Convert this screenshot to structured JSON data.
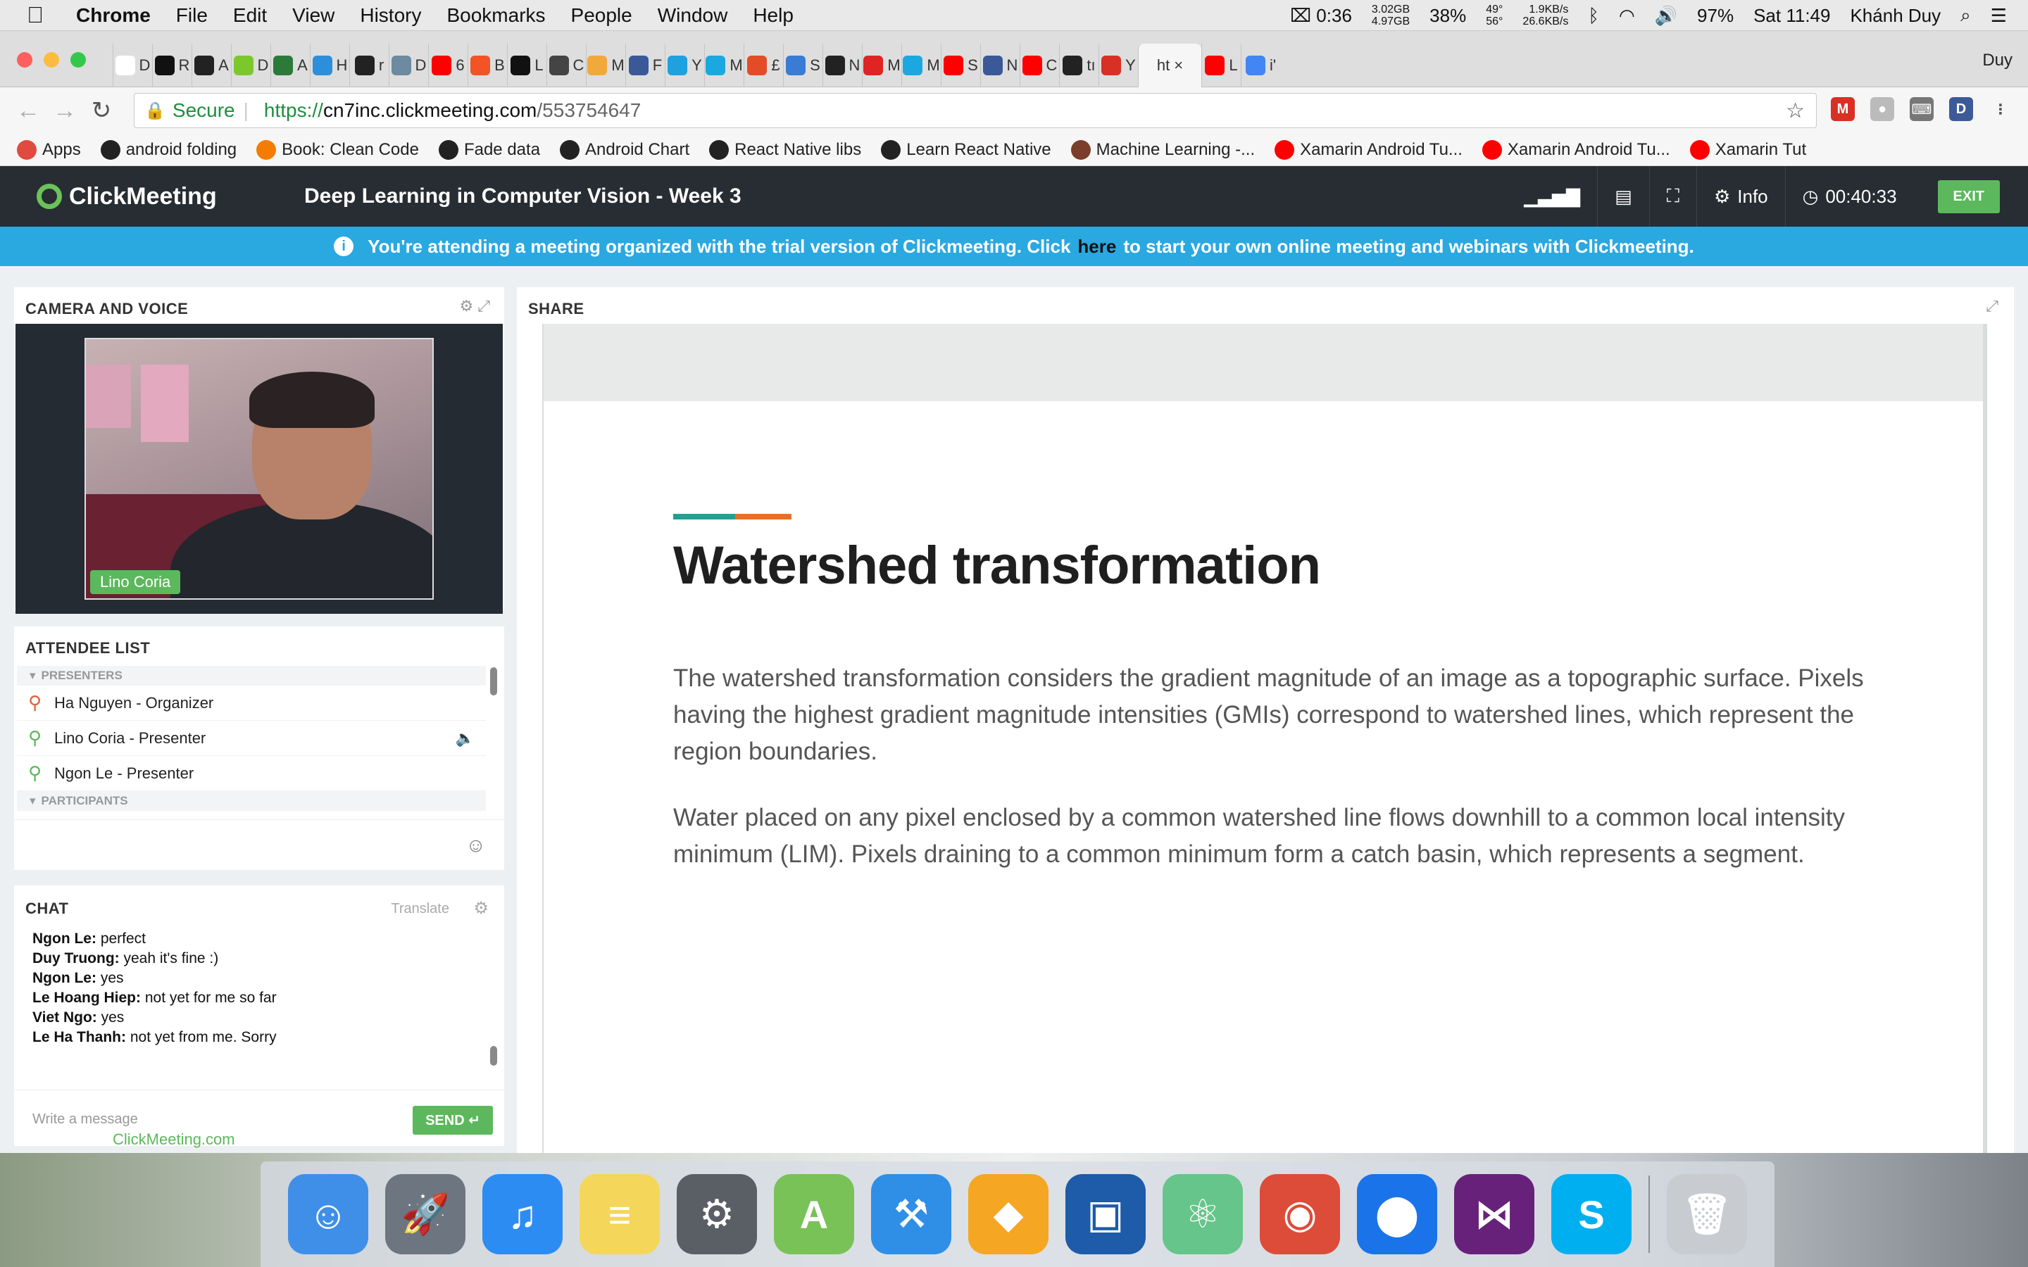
{
  "menubar": {
    "apple": "",
    "items": [
      "Chrome",
      "File",
      "Edit",
      "View",
      "History",
      "Bookmarks",
      "People",
      "Window",
      "Help"
    ],
    "status": {
      "battery_timer": "0:36",
      "mem_used": "3.02GB",
      "mem_free": "4.97GB",
      "cpu": "38%",
      "temp_hi": "49°",
      "temp_lo": "56°",
      "net_up": "1.9KB/s",
      "net_down": "26.6KB/s",
      "battery": "97%",
      "clock": "Sat 11:49",
      "user": "Khánh Duy"
    }
  },
  "browser": {
    "profile": "Duy",
    "tabs": [
      {
        "letter": "D",
        "color": "#ffffff",
        "icon": "chrome-icon"
      },
      {
        "letter": "R",
        "color": "#111111",
        "icon": "medium-icon"
      },
      {
        "letter": "A",
        "color": "#222222",
        "icon": "github-icon"
      },
      {
        "letter": "D",
        "color": "#7cc82c",
        "icon": "smiley-icon"
      },
      {
        "letter": "A",
        "color": "#2b7a3a",
        "icon": "star-icon"
      },
      {
        "letter": "H",
        "color": "#2d8fd9",
        "icon": "p-icon"
      },
      {
        "letter": "r",
        "color": "#222222",
        "icon": "github-icon"
      },
      {
        "letter": "D",
        "color": "#6c8aa0",
        "icon": "bird-icon"
      },
      {
        "letter": "6",
        "color": "#ff0000",
        "icon": "youtube-icon"
      },
      {
        "letter": "B",
        "color": "#f35325",
        "icon": "windows-icon"
      },
      {
        "letter": "L",
        "color": "#111111",
        "icon": "medium-icon"
      },
      {
        "letter": "C",
        "color": "#444444",
        "icon": "italic-i-icon"
      },
      {
        "letter": "M",
        "color": "#f2a93b",
        "icon": "sketch-icon"
      },
      {
        "letter": "F",
        "color": "#3b5998",
        "icon": "facebook-icon"
      },
      {
        "letter": "Y",
        "color": "#1fa1e0",
        "icon": "tn-icon"
      },
      {
        "letter": "M",
        "color": "#1ba8e0",
        "icon": "tiki-icon"
      },
      {
        "letter": "£",
        "color": "#e34c26",
        "icon": "chrome-icon"
      },
      {
        "letter": "S",
        "color": "#3a7bd5",
        "icon": "slash-icon"
      },
      {
        "letter": "N",
        "color": "#222222",
        "icon": "github-icon"
      },
      {
        "letter": "M",
        "color": "#e02424",
        "icon": "bolt-icon"
      },
      {
        "letter": "M",
        "color": "#1ba8e0",
        "icon": "tiki-icon"
      },
      {
        "letter": "S",
        "color": "#ff0000",
        "icon": "youtube-icon"
      },
      {
        "letter": "N",
        "color": "#3b5998",
        "icon": "facebook-icon"
      },
      {
        "letter": "C",
        "color": "#ff0000",
        "icon": "youtube-icon"
      },
      {
        "letter": "tı",
        "color": "#222222",
        "icon": "github-icon"
      },
      {
        "letter": "Y",
        "color": "#d93025",
        "icon": "gmail-icon"
      },
      {
        "letter": "ht",
        "color": "#f6f6f6",
        "icon": "active-tab",
        "active": true
      },
      {
        "letter": "L",
        "color": "#ff0000",
        "icon": "youtube-icon"
      },
      {
        "letter": "i'",
        "color": "#4285f4",
        "icon": "google-icon"
      }
    ],
    "url_secure": "Secure",
    "url_scheme": "https://",
    "url_host": "cn7inc.clickmeeting.com",
    "url_path": "/553754647",
    "bookmarks": [
      {
        "label": "Apps",
        "color": "#e04a3f",
        "icon": "apps-grid-icon"
      },
      {
        "label": "android folding",
        "color": "#222222",
        "icon": "github-icon"
      },
      {
        "label": "Book: Clean Code",
        "color": "#f57c00",
        "icon": "blogger-icon"
      },
      {
        "label": "Fade data",
        "color": "#222222",
        "icon": "github-icon"
      },
      {
        "label": "Android Chart",
        "color": "#222222",
        "icon": "github-icon"
      },
      {
        "label": "React Native libs",
        "color": "#222222",
        "icon": "github-icon"
      },
      {
        "label": "Learn React Native",
        "color": "#222222",
        "icon": "github-icon"
      },
      {
        "label": "Machine Learning -...",
        "color": "#7a3e2a",
        "icon": "image-icon"
      },
      {
        "label": "Xamarin Android Tu...",
        "color": "#ff0000",
        "icon": "youtube-icon"
      },
      {
        "label": "Xamarin Android Tu...",
        "color": "#ff0000",
        "icon": "youtube-icon"
      },
      {
        "label": "Xamarin Tut",
        "color": "#ff0000",
        "icon": "youtube-icon"
      }
    ]
  },
  "meeting": {
    "brand": "ClickMeeting",
    "title": "Deep Learning in Computer Vision - Week 3",
    "info_label": "Info",
    "timer": "00:40:33",
    "exit_label": "EXIT",
    "banner_before": "You're attending a meeting organized with the trial version of Clickmeeting. Click",
    "banner_link": "here",
    "banner_after": "to start your own online meeting and webinars with Clickmeeting.",
    "camera": {
      "title": "CAMERA AND VOICE",
      "presenter_name": "Lino Coria"
    },
    "attendees": {
      "title": "ATTENDEE LIST",
      "presenters_label": "PRESENTERS",
      "participants_label": "PARTICIPANTS",
      "presenters": [
        {
          "name": "Ha Nguyen  - Organizer",
          "color": "#e0603a"
        },
        {
          "name": "Lino Coria  - Presenter",
          "color": "#5cb85c"
        },
        {
          "name": "Ngon Le  - Presenter",
          "color": "#5cb85c"
        }
      ]
    },
    "chat": {
      "title": "CHAT",
      "translate_label": "Translate",
      "messages": [
        {
          "author": "Ngon Le:",
          "text": " perfect"
        },
        {
          "author": "Duy Truong:",
          "text": " yeah it's fine :)"
        },
        {
          "author": "Ngon Le:",
          "text": " yes"
        },
        {
          "author": "Le Hoang Hiep:",
          "text": " not yet for me so far"
        },
        {
          "author": "Viet Ngo:",
          "text": " yes"
        },
        {
          "author": "Le Ha Thanh:",
          "text": " not yet from me. Sorry"
        }
      ],
      "input_placeholder": "Write a message",
      "send_label": "SEND"
    },
    "share": {
      "title": "SHARE",
      "slide_title": "Watershed transformation",
      "paragraph1": "The watershed transformation considers the gradient magnitude of an image as a topographic surface. Pixels having the highest gradient magnitude intensities (GMIs) correspond to watershed lines, which represent the region boundaries.",
      "paragraph2": "Water placed on any pixel enclosed by a common watershed line flows downhill to a common local intensity minimum (LIM). Pixels draining to a common minimum form a catch basin, which represents a segment."
    },
    "footer_brand": "ClickMeeting.com"
  },
  "dock": [
    {
      "icon": "finder-icon",
      "color": "#3f8fe8",
      "glyph": "☺"
    },
    {
      "icon": "launchpad-icon",
      "color": "#6d7680",
      "glyph": "🚀"
    },
    {
      "icon": "itunes-icon",
      "color": "#2c8cf2",
      "glyph": "♫"
    },
    {
      "icon": "notes-icon",
      "color": "#f4d65a",
      "glyph": "≡"
    },
    {
      "icon": "system-preferences-icon",
      "color": "#5a5f66",
      "glyph": "⚙"
    },
    {
      "icon": "android-studio-icon",
      "color": "#78c257",
      "glyph": "A"
    },
    {
      "icon": "xcode-icon",
      "color": "#2f8fe6",
      "glyph": "⚒"
    },
    {
      "icon": "sketch-icon",
      "color": "#f5a623",
      "glyph": "◆"
    },
    {
      "icon": "virtualbox-icon",
      "color": "#1e5ba8",
      "glyph": "▣"
    },
    {
      "icon": "atom-icon",
      "color": "#66c58a",
      "glyph": "⚛"
    },
    {
      "icon": "chrome-icon",
      "color": "#dd4b39",
      "glyph": "◉"
    },
    {
      "icon": "pin-icon",
      "color": "#1a73e8",
      "glyph": "⬤"
    },
    {
      "icon": "visual-studio-icon",
      "color": "#68217a",
      "glyph": "⋈"
    },
    {
      "icon": "skype-icon",
      "color": "#00aff0",
      "glyph": "S"
    },
    {
      "icon": "trash-icon",
      "color": "#c8ccd1",
      "glyph": "🗑"
    }
  ]
}
